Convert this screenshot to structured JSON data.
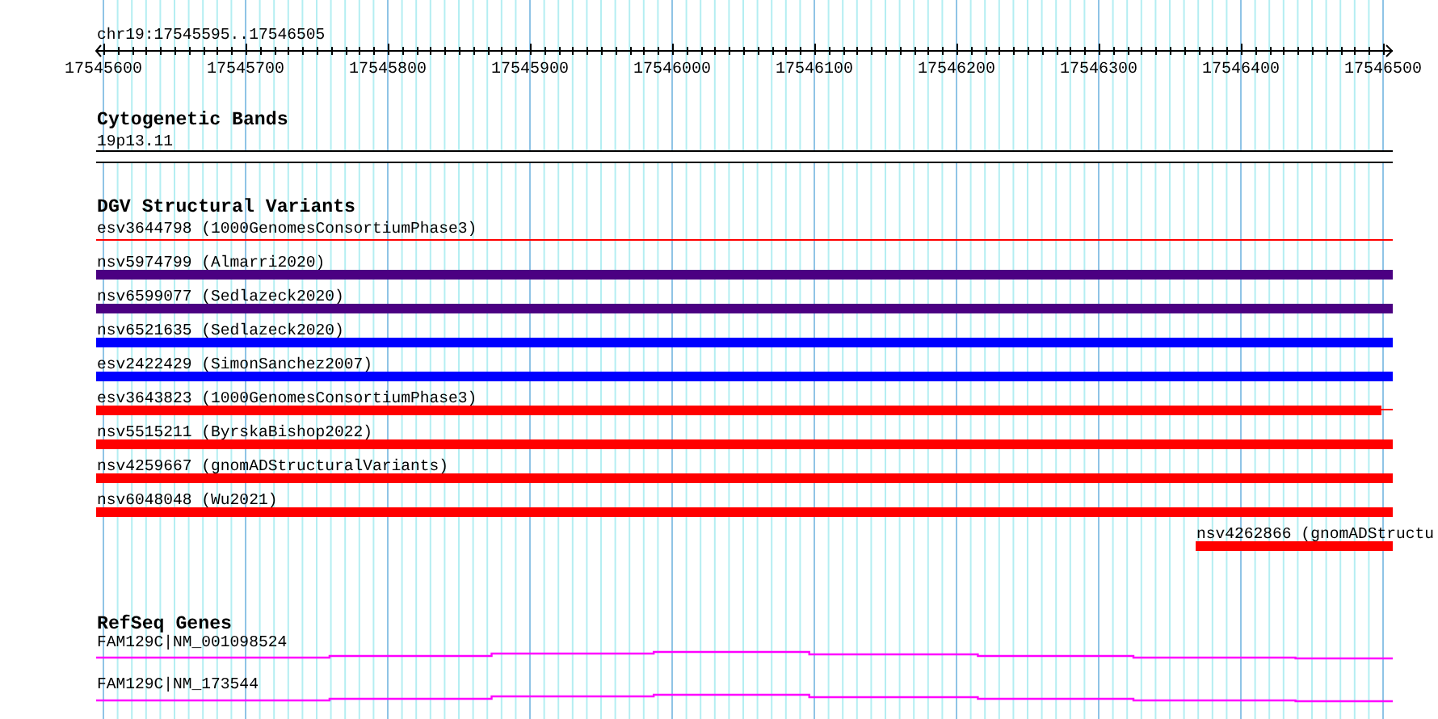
{
  "ruler": {
    "region": "chr19:17545595..17546505",
    "ticks": [
      "17545600",
      "17545700",
      "17545800",
      "17545900",
      "17546000",
      "17546100",
      "17546200",
      "17546300",
      "17546400",
      "17546500"
    ]
  },
  "tracks": [
    {
      "kind": "bands",
      "title": "Cytogenetic Bands",
      "features": [
        {
          "label": "19p13.11"
        }
      ]
    },
    {
      "kind": "variants",
      "title": "DGV Structural Variants",
      "features": [
        {
          "label": "esv3644798 (1000GenomesConsortiumPhase3)",
          "kind": "line",
          "color": "#ff0000"
        },
        {
          "label": "nsv5974799 (Almarri2020)",
          "kind": "bar",
          "color": "#4b0082"
        },
        {
          "label": "nsv6599077 (Sedlazeck2020)",
          "kind": "bar",
          "color": "#4b0082"
        },
        {
          "label": "nsv6521635 (Sedlazeck2020)",
          "kind": "bar",
          "color": "#0000ff"
        },
        {
          "label": "esv2422429 (SimonSanchez2007)",
          "kind": "bar",
          "color": "#0000ff"
        },
        {
          "label": "esv3643823 (1000GenomesConsortiumPhase3)",
          "kind": "tailed",
          "color": "#ff0000"
        },
        {
          "label": "nsv5515211 (ByrskaBishop2022)",
          "kind": "bar",
          "color": "#ff0000"
        },
        {
          "label": "nsv4259667 (gnomADStructuralVariants)",
          "kind": "bar",
          "color": "#ff0000"
        },
        {
          "label": "nsv6048048 (Wu2021)",
          "kind": "bar",
          "color": "#ff0000"
        },
        {
          "label": "nsv4262866 (gnomADStructu",
          "kind": "right",
          "color": "#ff0000",
          "level": 0.152
        }
      ]
    },
    {
      "kind": "genes",
      "title": "RefSeq Genes",
      "features": [
        {
          "label": "FAM129C|NM_001098524"
        },
        {
          "label": "FAM129C|NM_173544"
        }
      ]
    }
  ]
}
